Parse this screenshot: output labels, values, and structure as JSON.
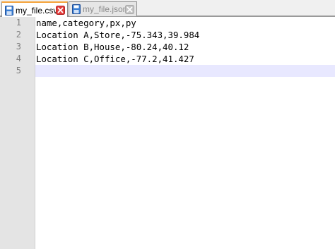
{
  "tabs": [
    {
      "label": "my_file.csv",
      "active": true,
      "icon": "floppy-disk-icon",
      "close_icon": "close-icon"
    },
    {
      "label": "my_file.json",
      "active": false,
      "icon": "floppy-disk-icon",
      "close_icon": "close-icon"
    }
  ],
  "editor": {
    "line_numbers": [
      "1",
      "2",
      "3",
      "4",
      "5"
    ],
    "lines": [
      "name,category,px,py",
      "Location A,Store,-75.343,39.984",
      "Location B,House,-80.24,40.12",
      "Location C,Office,-77.2,41.427",
      ""
    ],
    "current_line": 5
  },
  "colors": {
    "active_tab_accent": "#f5a33a",
    "close_active": "#e23d3d",
    "close_inactive": "#a8a8a8",
    "gutter_bg": "#e4e4e4",
    "current_line_bg": "#e8e8ff"
  }
}
